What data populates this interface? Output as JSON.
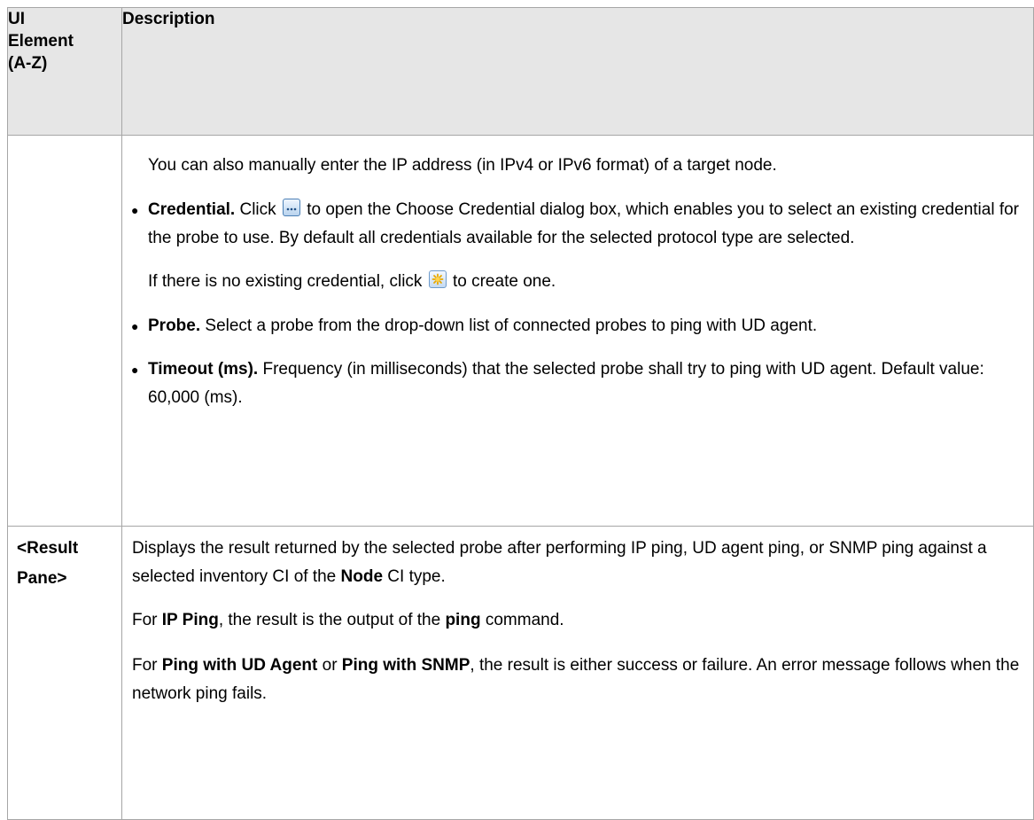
{
  "table": {
    "header": {
      "element_lines": [
        "UI",
        "Element",
        "(A-Z)"
      ],
      "description": "Description"
    },
    "row1": {
      "element": "",
      "intro": "You can also manually enter the IP address (in IPv4 or IPv6 format) of a target node.",
      "credential": {
        "term": "Credential.",
        "before_icon": " Click ",
        "icon": "ellipsis-icon",
        "after_icon": " to open the Choose Credential dialog box, which enables you to select an existing credential for the probe to use. By default all credentials available for the selected protocol type are selected."
      },
      "no_credential": {
        "before_icon": "If there is no existing credential, click ",
        "icon": "new-icon",
        "after_icon": " to create one."
      },
      "probe": {
        "term": "Probe.",
        "text": " Select a probe from the drop-down list of connected probes to ping with UD agent."
      },
      "timeout": {
        "term": "Timeout (ms).",
        "text": " Frequency (in milliseconds) that the selected probe shall try to ping with UD agent. Default value: 60,000 (ms)."
      }
    },
    "row2": {
      "element_lines": [
        "<Result",
        "Pane>"
      ],
      "p1": {
        "text": "Displays the result returned by the selected probe after performing IP ping, UD agent ping, or SNMP ping against a selected inventory CI of the ",
        "bold": "Node",
        "tail": " CI type."
      },
      "p2": {
        "lead": "For ",
        "bold1": "IP Ping",
        "mid": ", the result is the output of the ",
        "bold2": "ping",
        "tail": " command."
      },
      "p3": {
        "lead": "For ",
        "bold1": "Ping with UD Agent",
        "mid": " or ",
        "bold2": "Ping with SNMP",
        "tail": ", the result is either success or failure. An error message follows when the network ping fails."
      }
    }
  },
  "colors": {
    "header_bg": "#e6e6e6",
    "border": "#a6a6a6",
    "text": "#000000"
  }
}
